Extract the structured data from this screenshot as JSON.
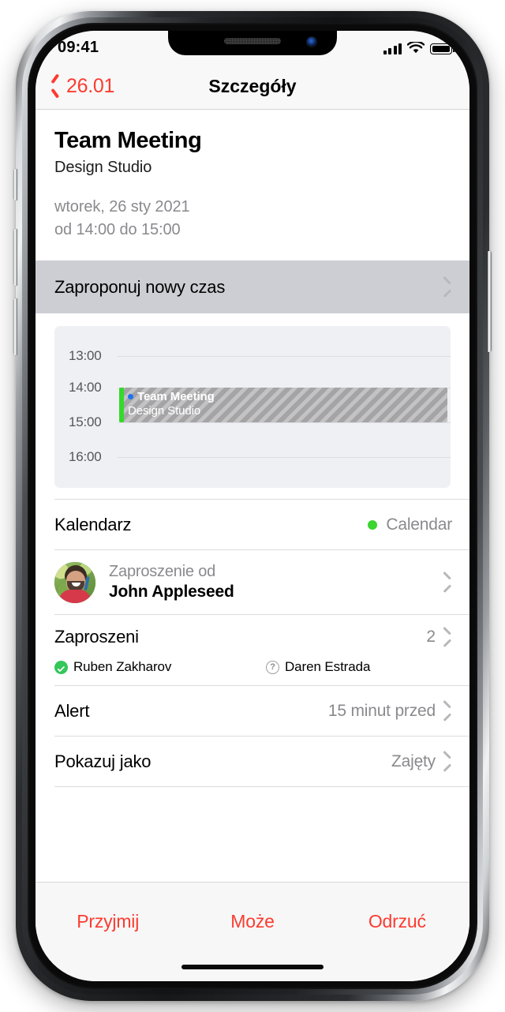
{
  "device": {
    "frame": "iphone-x-silver"
  },
  "statusbar": {
    "time": "09:41",
    "signal_icon": "cellular-bars-icon",
    "wifi_icon": "wifi-icon",
    "battery_icon": "battery-full-icon"
  },
  "navbar": {
    "back_label": "26.01",
    "title": "Szczegóły"
  },
  "event": {
    "title": "Team Meeting",
    "location": "Design Studio",
    "date": "wtorek, 26 sty 2021",
    "time_range": "od 14:00 do 15:00"
  },
  "propose": {
    "label": "Zaproponuj nowy czas"
  },
  "calendar_preview": {
    "hours": [
      "13:00",
      "14:00",
      "15:00",
      "16:00"
    ],
    "event": {
      "title": "Team Meeting",
      "location": "Design Studio",
      "dot_color": "#2173f0",
      "edge_color": "#35d92b",
      "block_color": "#a4a4a6"
    }
  },
  "rows": {
    "calendar": {
      "label": "Kalendarz",
      "value": "Calendar",
      "dot_color": "#3ad52e"
    },
    "invitation": {
      "from_label": "Zaproszenie od",
      "name": "John Appleseed"
    },
    "invitees": {
      "label": "Zaproszeni",
      "count": "2",
      "people": [
        {
          "name": "Ruben Zakharov",
          "status": "accepted",
          "icon": "check-circle-icon"
        },
        {
          "name": "Daren Estrada",
          "status": "pending",
          "icon": "question-circle-icon",
          "glyph": "?"
        }
      ]
    },
    "alert": {
      "label": "Alert",
      "value": "15 minut przed"
    },
    "show_as": {
      "label": "Pokazuj jako",
      "value": "Zajęty"
    }
  },
  "actions": {
    "accept": "Przyjmij",
    "maybe": "Może",
    "decline": "Odrzuć",
    "color": "#fc3b30"
  }
}
